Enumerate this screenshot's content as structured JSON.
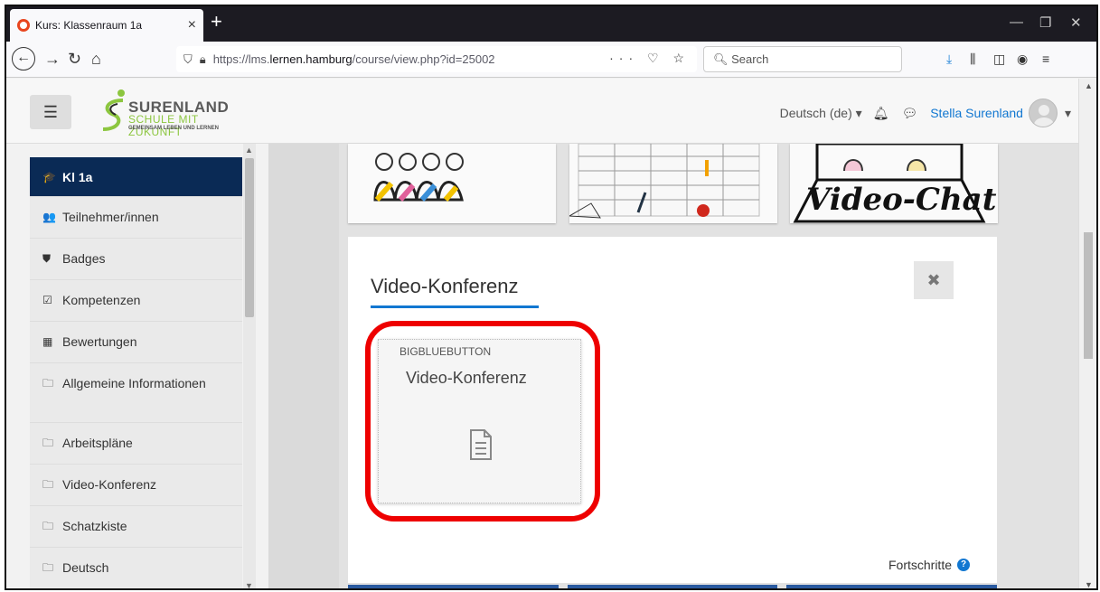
{
  "browser": {
    "tab_title": "Kurs: Klassenraum 1a",
    "tab_close": "×",
    "new_tab": "+",
    "url_prefix": "https://lms.",
    "url_domain": "lernen.hamburg",
    "url_suffix": "/course/view.php?id=25002",
    "url_tail": "··· ♡ ☆",
    "search_placeholder": "Search",
    "win_min": "—",
    "win_restore": "❐",
    "win_close": "✕"
  },
  "header": {
    "menu_icon": "☰",
    "logo_name": "SURENLAND",
    "logo_tag1": "SCHULE MIT ZUKUNFT",
    "logo_tag2": "GEMEINSAM LEBEN UND LERNEN",
    "language": "Deutsch (de) ▾",
    "user_name": "Stella Surenland",
    "user_caret": "▾"
  },
  "sidebar": {
    "items": [
      {
        "icon": "🎓",
        "label": "Kl 1a"
      },
      {
        "icon": "👥",
        "label": "Teilnehmer/innen"
      },
      {
        "icon": "⛊",
        "label": "Badges"
      },
      {
        "icon": "☑",
        "label": "Kompetenzen"
      },
      {
        "icon": "▦",
        "label": "Bewertungen"
      },
      {
        "icon": "🗀",
        "label": "Allgemeine Informationen"
      },
      {
        "icon": "🗀",
        "label": "Arbeitspläne"
      },
      {
        "icon": "🗀",
        "label": "Video-Konferenz"
      },
      {
        "icon": "🗀",
        "label": "Schatzkiste"
      },
      {
        "icon": "🗀",
        "label": "Deutsch"
      }
    ]
  },
  "tiles": {
    "chat_label": "Video-Chat"
  },
  "modal": {
    "title": "Video-Konferenz",
    "close_icon": "✖",
    "card_type": "BIGBLUEBUTTON",
    "card_title": "Video-Konferenz",
    "progress_label": "Fortschritte",
    "help_icon": "?"
  },
  "colors": {
    "accent": "#1177d1",
    "active_nav": "#0a2a55",
    "highlight": "#e00000"
  }
}
